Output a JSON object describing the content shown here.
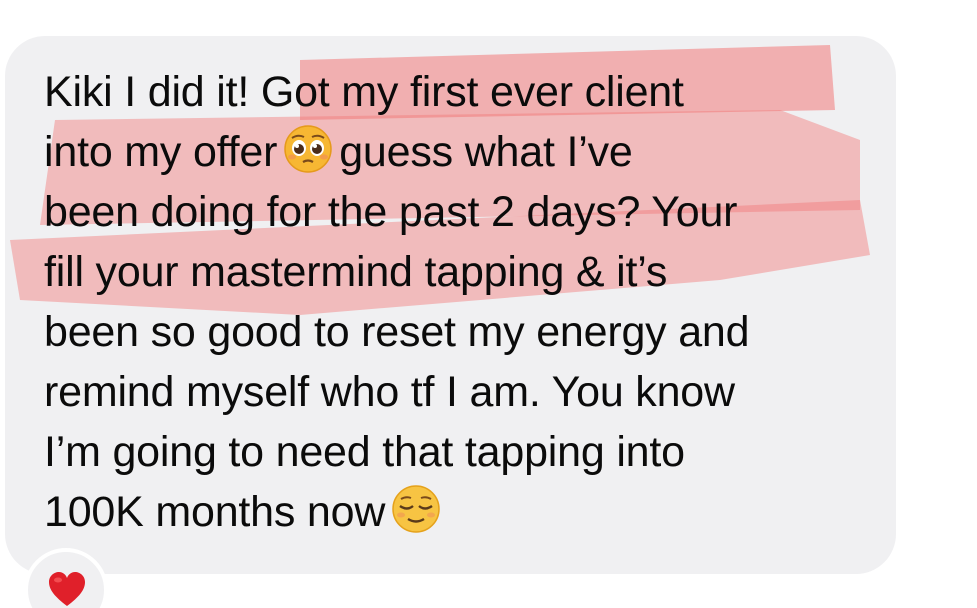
{
  "message": {
    "lines": [
      "Kiki I did it! Got my first ever client",
      "into my offer",
      "guess what I’ve",
      "been doing for the past 2 days? Your",
      "fill your mastermind tapping & it’s",
      "been so good to reset my energy and",
      "remind myself who tf I am. You know",
      "I’m going to need that tapping into",
      "100K months now"
    ],
    "emoji_1": "pleading-face-icon",
    "emoji_2": "relieved-face-icon"
  },
  "reaction": {
    "icon": "red-heart-icon"
  },
  "colors": {
    "bubble": "#f0f0f2",
    "text": "#0b0b0b",
    "highlight": "#f27a7a",
    "heart": "#e0202a"
  }
}
